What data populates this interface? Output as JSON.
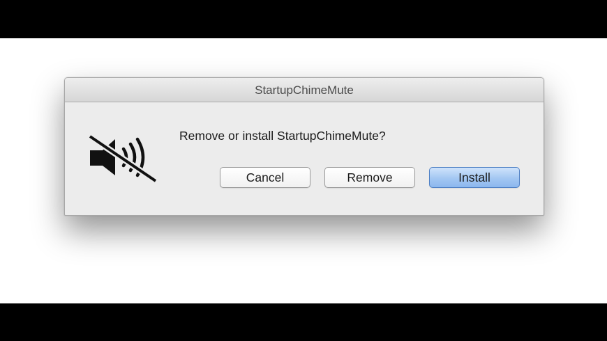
{
  "dialog": {
    "title": "StartupChimeMute",
    "message": "Remove or install StartupChimeMute?",
    "icon": "speaker-muted-icon",
    "buttons": {
      "cancel": "Cancel",
      "remove": "Remove",
      "install": "Install"
    },
    "default_button_color": "#a3c7f2"
  }
}
